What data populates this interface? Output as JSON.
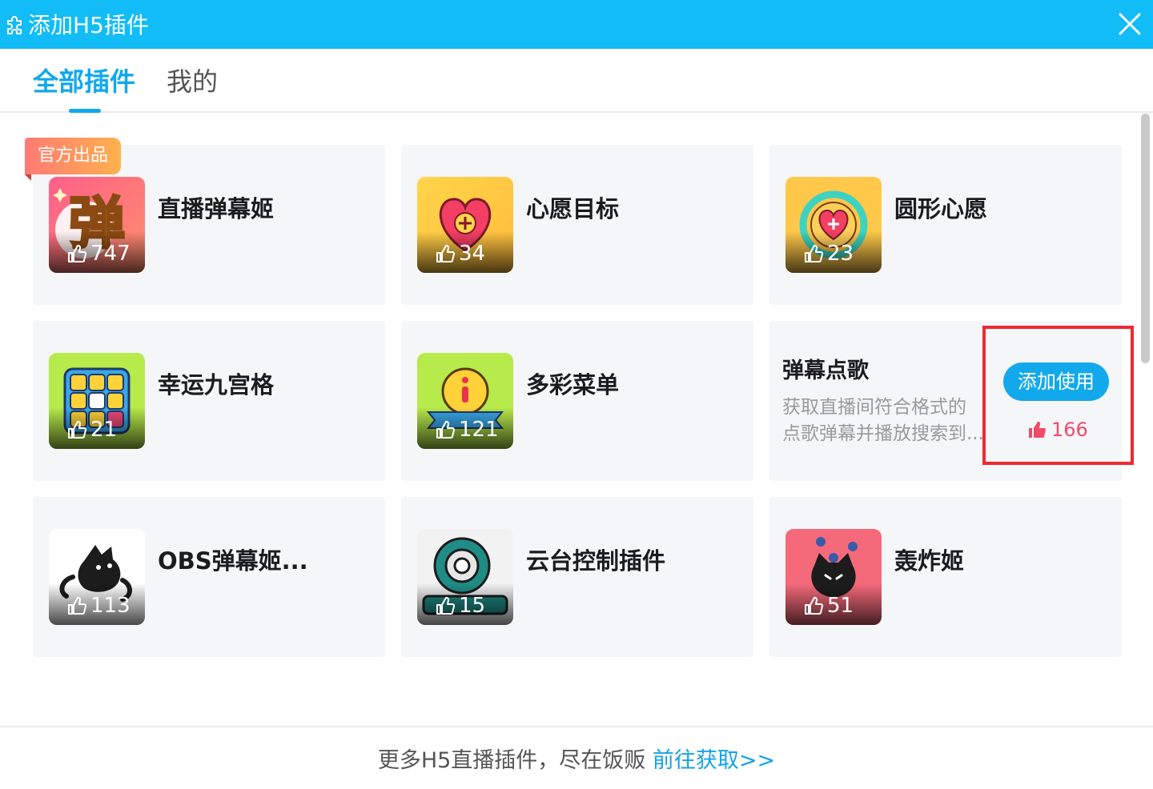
{
  "window": {
    "title": "添加H5插件",
    "colors": {
      "titlebar": "#12bcf6",
      "accent": "#10a8ec",
      "like": "#ef4a6a",
      "highlight": "#ee2a32"
    }
  },
  "tabs": [
    {
      "label": "全部插件",
      "active": true
    },
    {
      "label": "我的",
      "active": false
    }
  ],
  "badge": {
    "official": "官方出品"
  },
  "plugins": [
    {
      "name": "直播弹幕姬",
      "likes": "747",
      "icon": "danmaku-char-icon"
    },
    {
      "name": "心愿目标",
      "likes": "34",
      "icon": "heart-plus-icon"
    },
    {
      "name": "圆形心愿",
      "likes": "23",
      "icon": "ring-heart-icon"
    },
    {
      "name": "幸运九宫格",
      "likes": "21",
      "icon": "nine-grid-icon"
    },
    {
      "name": "多彩菜单",
      "likes": "121",
      "icon": "info-icon"
    },
    {
      "name": "弹幕点歌",
      "likes": "166",
      "icon": "thumbs-up-icon",
      "description": [
        "获取直播间符合格式的",
        "点歌弹幕并播放搜索到..."
      ],
      "action_label": "添加使用",
      "hovered": true
    },
    {
      "name": "OBS弹幕姬...",
      "likes": "113",
      "icon": "black-cat-icon"
    },
    {
      "name": "云台控制插件",
      "likes": "15",
      "icon": "webcam-icon"
    },
    {
      "name": "轰炸姬",
      "likes": "51",
      "icon": "cat-bomb-icon"
    }
  ],
  "footer": {
    "text": "更多H5直播插件，尽在饭贩 ",
    "link": "前往获取>>"
  }
}
